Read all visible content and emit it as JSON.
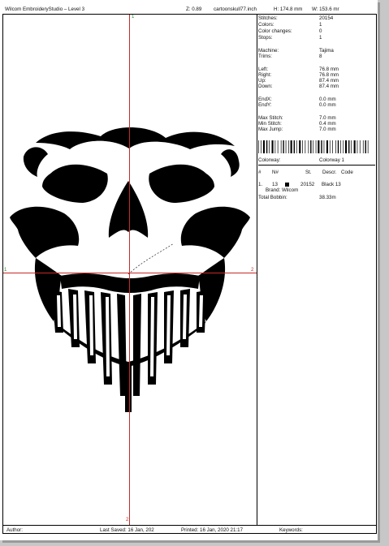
{
  "header": {
    "title": "Wilcom EmbroideryStudio – Level 3",
    "zoom": "Z: 0.89",
    "file": "cartoonskull77.inch",
    "height": "H: 174.8 mm",
    "width": "W: 153.6 mr"
  },
  "guides": {
    "top_marker": "1",
    "left_marker": "1",
    "right_marker": "2",
    "bottom_marker": "2"
  },
  "stats": [
    {
      "label": "Stitches:",
      "value": "20154"
    },
    {
      "label": "Colors:",
      "value": "1"
    },
    {
      "label": "Color changes:",
      "value": "0"
    },
    {
      "label": "Stops:",
      "value": "1"
    },
    {
      "label": "Machine:",
      "value": "Tajima"
    },
    {
      "label": "Trims:",
      "value": "8"
    },
    {
      "label": "Left:",
      "value": "76.8 mm"
    },
    {
      "label": "Right:",
      "value": "76.8 mm"
    },
    {
      "label": "Up:",
      "value": "87.4 mm"
    },
    {
      "label": "Down:",
      "value": "87.4 mm"
    },
    {
      "label": "EndX:",
      "value": "0.0 mm"
    },
    {
      "label": "EndY:",
      "value": "0.0 mm"
    },
    {
      "label": "Max Stitch:",
      "value": "7.0 mm"
    },
    {
      "label": "Min Stitch:",
      "value": "0.4 mm"
    },
    {
      "label": "Max Jump:",
      "value": "7.0 mm"
    }
  ],
  "colorway": {
    "label": "Colorway:",
    "value": "Colorway 1"
  },
  "color_table": {
    "headers": [
      "#",
      "N#",
      "St.",
      "Descr.",
      "Code"
    ],
    "rows": [
      {
        "index": "1.",
        "needle": "13",
        "stitches": "20152",
        "description": "Black 13",
        "brand": "Brand: Wilcom",
        "swatch_color": "#000000"
      }
    ]
  },
  "total_bobbin": {
    "label": "Total Bobbin:",
    "value": "38.33m"
  },
  "footer": {
    "author": "Author:",
    "last_saved": "Last Saved: 16 Jan, 202",
    "printed": "Printed: 16 Jan, 2020 21:17",
    "keywords": "Keywords:"
  },
  "colors": {
    "guide": "#c62828",
    "axis_label": "#2a8a2a",
    "thread": "#000000"
  }
}
